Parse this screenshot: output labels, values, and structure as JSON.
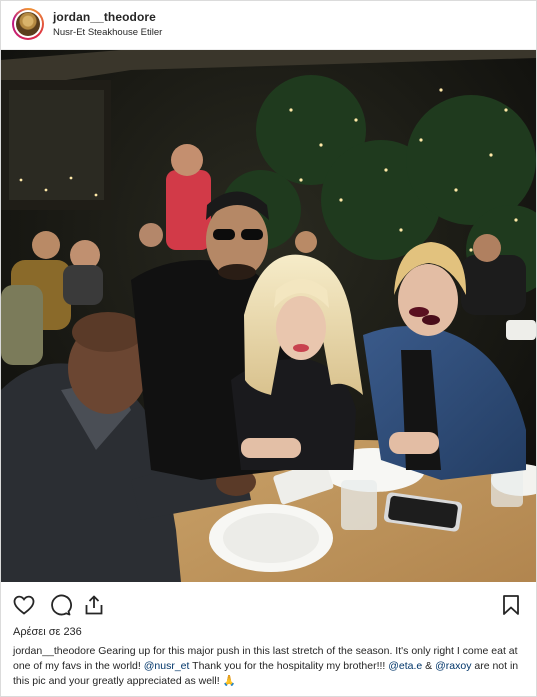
{
  "post": {
    "username": "jordan__theodore",
    "location": "Nusr-Et Steakhouse Etiler",
    "likes_text": "Αρέσει σε 236",
    "caption": {
      "author": "jordan__theodore",
      "text_1": " Gearing up for this major push in this last stretch of the season. It's only right I come eat at one of my favs in the world! ",
      "mention_1": "@nusr_et",
      "text_2": " Thank you for the hospitality my brother!!! ",
      "mention_2": "@eta.e",
      "text_3": " & ",
      "mention_3": "@raxoy",
      "text_4": " are not in this pic and your greatly appreciated as well! ",
      "emoji": "🙏"
    }
  },
  "icons": {
    "like": "heart-icon",
    "comment": "comment-icon",
    "share": "share-icon",
    "save": "bookmark-icon"
  },
  "colors": {
    "text": "#262626",
    "mention": "#003569",
    "border": "#dbdbdb"
  }
}
